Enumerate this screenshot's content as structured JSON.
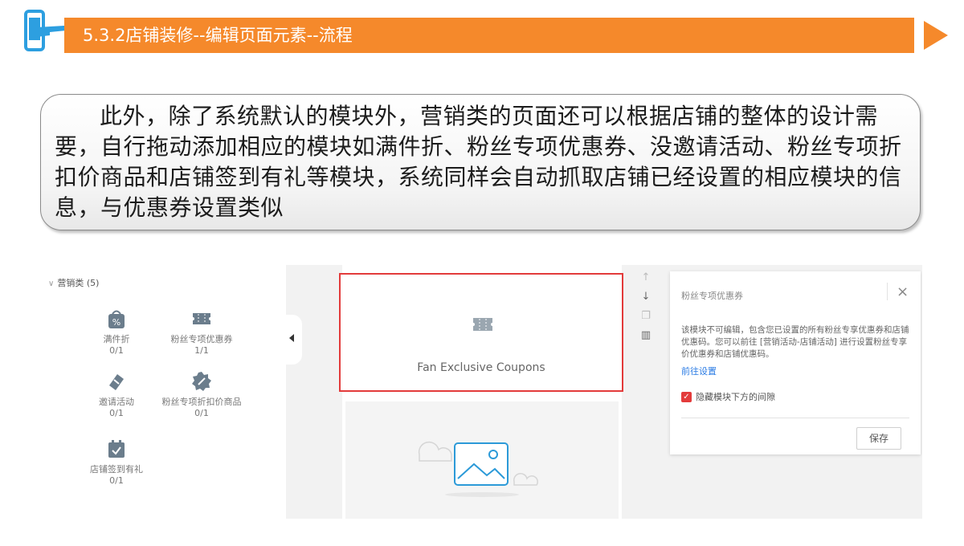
{
  "header": {
    "title": "5.3.2店铺装修--编辑页面元素--流程",
    "accent_color": "#f5892b",
    "icon": "hand-pointing-phone-icon"
  },
  "callout": {
    "text": "此外，除了系统默认的模块外，营销类的页面还可以根据店铺的整体的设计需要，自行拖动添加相应的模块如满件折、粉丝专项优惠券、没邀请活动、粉丝专项折扣价商品和店铺签到有礼等模块，系统同样会自动抓取店铺已经设置的相应模块的信息，与优惠券设置类似"
  },
  "screenshot": {
    "left_panel": {
      "category": "营销类 (5)",
      "modules": [
        {
          "name": "满件折",
          "count": "0/1",
          "icon": "percent-bag-icon"
        },
        {
          "name": "粉丝专项优惠券",
          "count": "1/1",
          "icon": "coupon-icon"
        },
        {
          "name": "邀请活动",
          "count": "0/1",
          "icon": "invite-tag-icon"
        },
        {
          "name": "粉丝专项折扣价商品",
          "count": "0/1",
          "icon": "discount-badge-icon"
        },
        {
          "name": "店铺签到有礼",
          "count": "0/1",
          "icon": "calendar-check-icon"
        }
      ]
    },
    "canvas": {
      "selected_module_label": "Fan Exclusive Coupons",
      "selection_color": "#e33b3b"
    },
    "tools": [
      "arrow-up-icon",
      "arrow-down-icon",
      "copy-icon",
      "trash-icon"
    ],
    "properties": {
      "title": "粉丝专项优惠券",
      "description": "该模块不可编辑，包含您已设置的所有粉丝专享优惠券和店铺优惠码。您可以前往 [营销活动-店铺活动] 进行设置粉丝专享价优惠券和店铺优惠码。",
      "link": "前往设置",
      "checkbox_label": "隐藏模块下方的间隙",
      "checkbox_checked": true,
      "save_label": "保存",
      "link_color": "#2a7be4"
    }
  }
}
